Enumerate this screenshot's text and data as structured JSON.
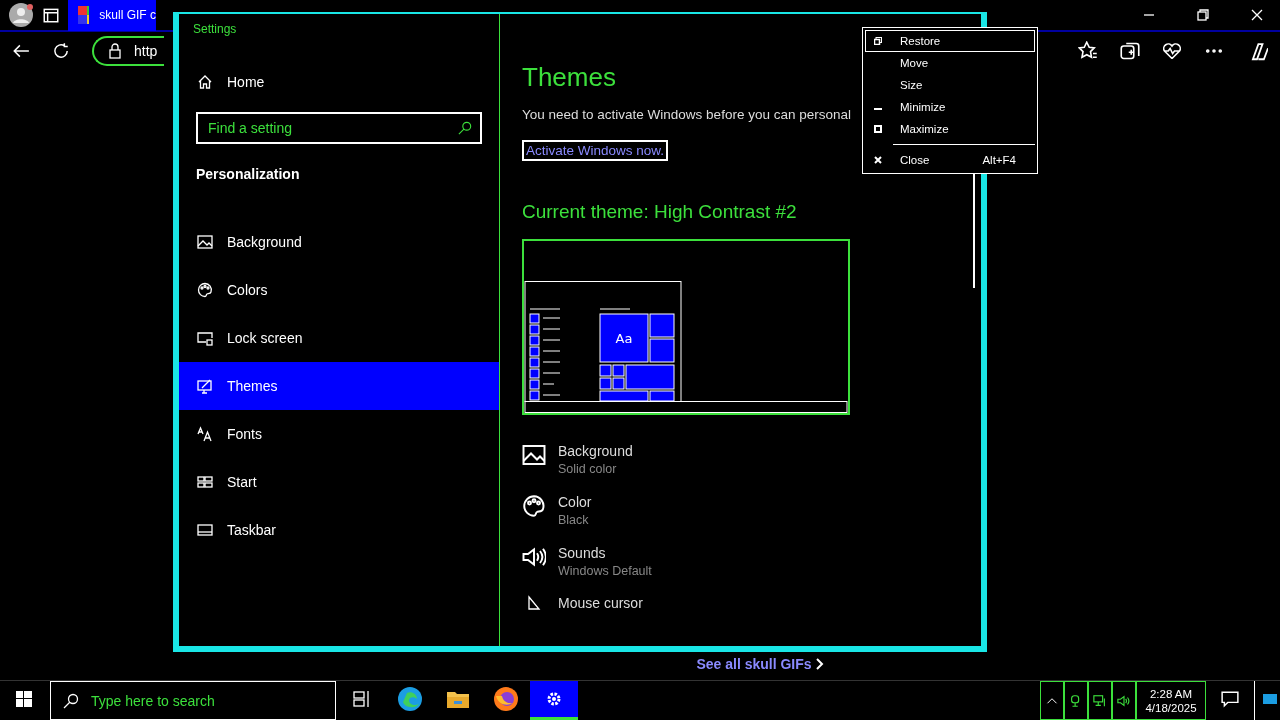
{
  "browser": {
    "tab_title": "skull GIF c",
    "address": "http",
    "footer_link": "See all skull GIFs"
  },
  "settings": {
    "title": "Settings",
    "home": "Home",
    "search": {
      "placeholder": "Find a setting"
    },
    "section": "Personalization",
    "nav": [
      {
        "label": "Background",
        "selected": false
      },
      {
        "label": "Colors",
        "selected": false
      },
      {
        "label": "Lock screen",
        "selected": false
      },
      {
        "label": "Themes",
        "selected": true
      },
      {
        "label": "Fonts",
        "selected": false
      },
      {
        "label": "Start",
        "selected": false
      },
      {
        "label": "Taskbar",
        "selected": false
      }
    ],
    "heading": "Themes",
    "notice": "You need to activate Windows before you can personal",
    "activate_link": "Activate Windows now.",
    "current_theme": "Current theme: High Contrast #2",
    "preview": {
      "sample": "Aa"
    },
    "properties": [
      {
        "kind": "picture",
        "title": "Background",
        "value": "Solid color"
      },
      {
        "kind": "palette",
        "title": "Color",
        "value": "Black"
      },
      {
        "kind": "sound",
        "title": "Sounds",
        "value": "Windows Default"
      },
      {
        "kind": "cursor",
        "title": "Mouse cursor"
      }
    ]
  },
  "menu": {
    "items": [
      {
        "kind": "item",
        "label": "Restore",
        "selected": true
      },
      {
        "kind": "item",
        "label": "Move",
        "selected": false
      },
      {
        "kind": "item",
        "label": "Size",
        "selected": false
      },
      {
        "kind": "item",
        "label": "Minimize",
        "selected": false
      },
      {
        "kind": "item",
        "label": "Maximize",
        "selected": false
      },
      {
        "kind": "separator"
      },
      {
        "kind": "item",
        "label": "Close",
        "shortcut": "Alt+F4",
        "selected": false
      }
    ]
  },
  "taskbar": {
    "search_placeholder": "Type here to search",
    "apps": [
      {
        "kind": "taskview",
        "selected": false
      },
      {
        "kind": "edge",
        "selected": false
      },
      {
        "kind": "folder",
        "selected": false
      },
      {
        "kind": "firefox",
        "selected": false
      },
      {
        "kind": "settings",
        "selected": true
      }
    ],
    "time": "2:28 AM",
    "date": "4/18/2025"
  }
}
